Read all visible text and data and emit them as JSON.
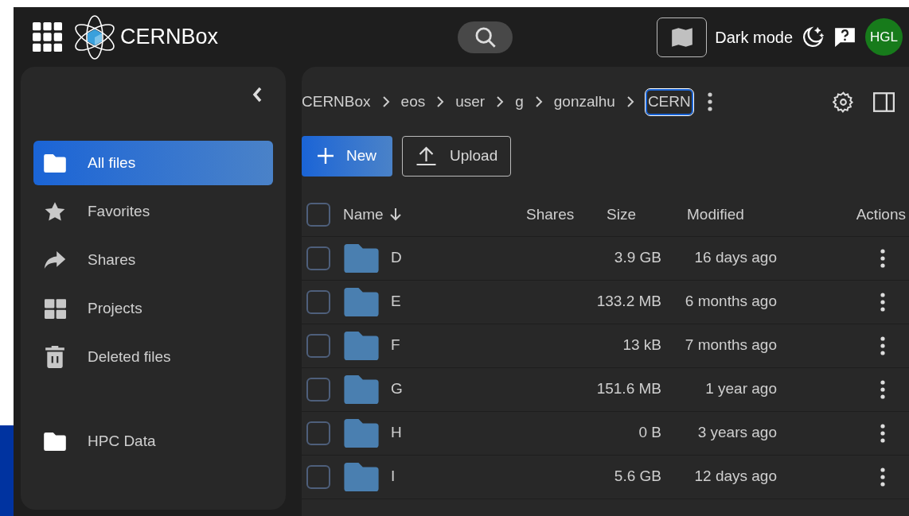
{
  "header": {
    "logo_text": "CERN**Box**",
    "dark_mode_label": "Dark mode",
    "avatar": "HGL"
  },
  "sidebar": {
    "sections": [
      [
        {
          "label": "All files",
          "kind": "folder",
          "selected": true
        },
        {
          "label": "Favorites",
          "kind": "star",
          "selected": false
        },
        {
          "label": "Shares",
          "kind": "share",
          "selected": false
        },
        {
          "label": "Projects",
          "kind": "grid",
          "selected": false
        },
        {
          "label": "Deleted files",
          "kind": "trash",
          "selected": false
        }
      ],
      [
        {
          "label": "HPC Data",
          "kind": "folder",
          "selected": false
        }
      ]
    ]
  },
  "breadcrumb": [
    {
      "label": "CERNBox",
      "selected": false
    },
    {
      "label": "eos",
      "selected": false
    },
    {
      "label": "user",
      "selected": false
    },
    {
      "label": "g",
      "selected": false
    },
    {
      "label": "gonzalhu",
      "selected": false
    },
    {
      "label": "CERN",
      "selected": true
    }
  ],
  "toolbar": {
    "new_button": "New",
    "upload_button": "Upload"
  },
  "table": {
    "select_all_checked": false,
    "columns": [
      {
        "label": "Name",
        "sorted": true
      },
      {
        "label": "Shares",
        "sorted": false
      },
      {
        "label": "Size",
        "sorted": false
      },
      {
        "label": "Modified",
        "sorted": false
      },
      {
        "label": "Actions",
        "sorted": false
      }
    ],
    "rows": [
      {
        "name": "D",
        "size": "3.9 GB",
        "modified": "16 days ago",
        "checked": false
      },
      {
        "name": "E",
        "size": "133.2 MB",
        "modified": "6 months ago",
        "checked": false
      },
      {
        "name": "F",
        "size": "13 kB",
        "modified": "7 months ago",
        "checked": false
      },
      {
        "name": "G",
        "size": "151.6 MB",
        "modified": "1 year ago",
        "checked": false
      },
      {
        "name": "H",
        "size": "0 B",
        "modified": "3 years ago",
        "checked": false
      },
      {
        "name": "I",
        "size": "5.6 GB",
        "modified": "12 days ago",
        "checked": false
      }
    ]
  }
}
